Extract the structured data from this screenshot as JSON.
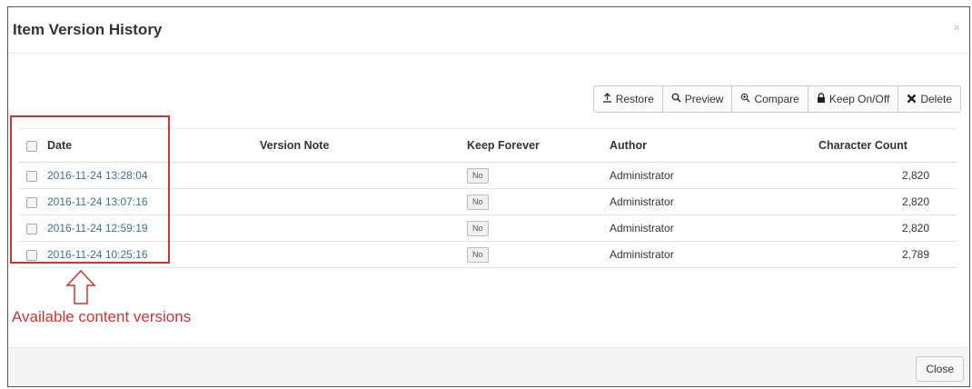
{
  "dialog": {
    "title": "Item Version History",
    "close_glyph": "×"
  },
  "toolbar": {
    "buttons": [
      {
        "label": "Restore",
        "icon": "upload-icon"
      },
      {
        "label": "Preview",
        "icon": "search-icon"
      },
      {
        "label": "Compare",
        "icon": "zoom-icon"
      },
      {
        "label": "Keep On/Off",
        "icon": "lock-icon"
      },
      {
        "label": "Delete",
        "icon": "x-icon"
      }
    ]
  },
  "table": {
    "headers": {
      "date": "Date",
      "note": "Version Note",
      "keep": "Keep Forever",
      "author": "Author",
      "count": "Character Count"
    },
    "rows": [
      {
        "date": "2016-11-24 13:28:04",
        "note": "",
        "keep": "No",
        "author": "Administrator",
        "count": "2,820"
      },
      {
        "date": "2016-11-24 13:07:16",
        "note": "",
        "keep": "No",
        "author": "Administrator",
        "count": "2,820"
      },
      {
        "date": "2016-11-24 12:59:19",
        "note": "",
        "keep": "No",
        "author": "Administrator",
        "count": "2,820"
      },
      {
        "date": "2016-11-24 10:25:16",
        "note": "",
        "keep": "No",
        "author": "Administrator",
        "count": "2,789"
      }
    ]
  },
  "footer": {
    "close_label": "Close"
  },
  "annotation": {
    "text": "Available content versions",
    "color": "#d0332f"
  }
}
